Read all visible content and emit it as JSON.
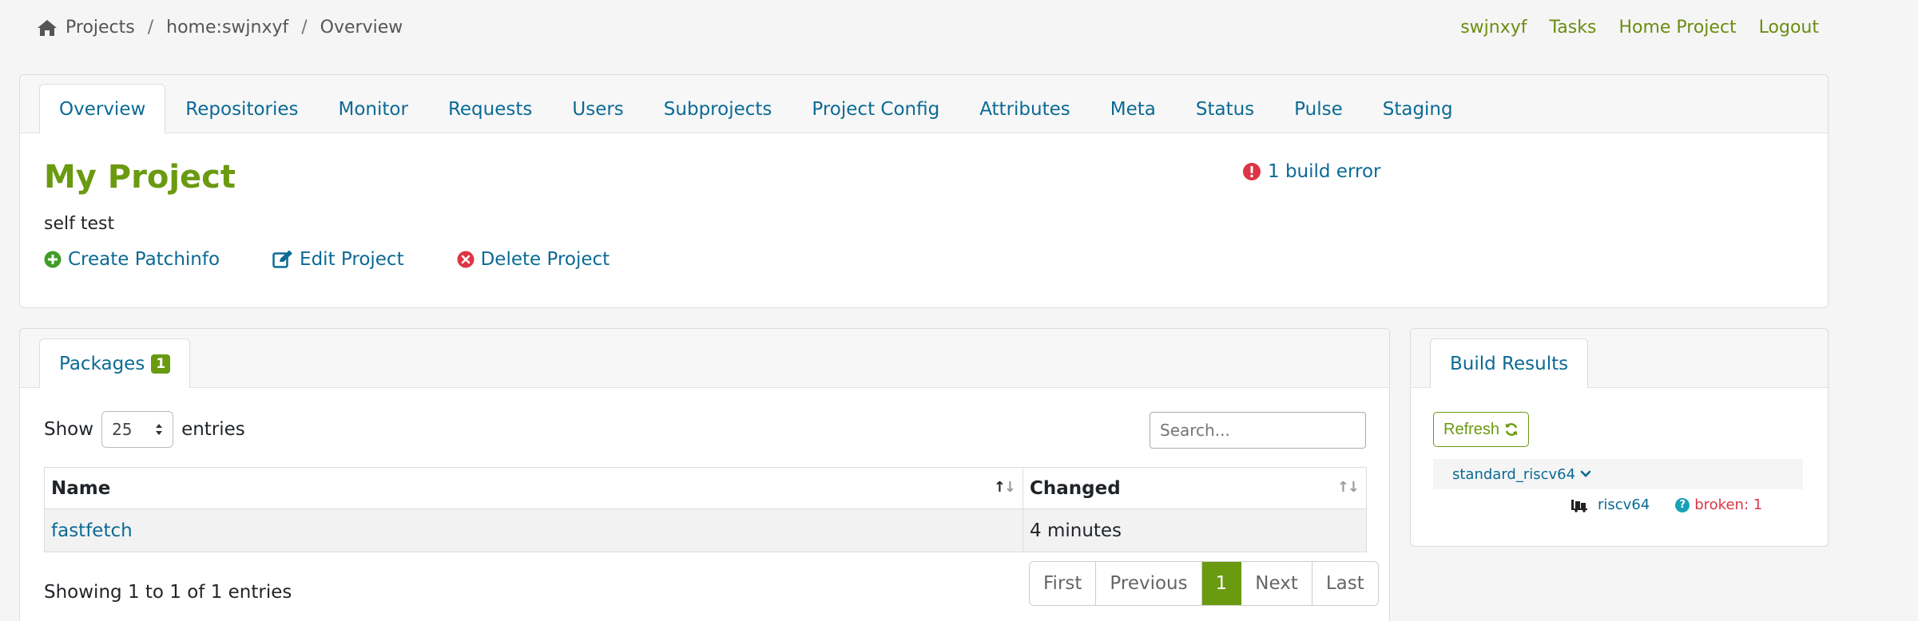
{
  "breadcrumb": {
    "items": [
      "Projects",
      "home:swjnxyf",
      "Overview"
    ],
    "separator": "/"
  },
  "user_nav": {
    "username": "swjnxyf",
    "tasks": "Tasks",
    "home_project": "Home Project",
    "logout": "Logout"
  },
  "project_tabs": [
    "Overview",
    "Repositories",
    "Monitor",
    "Requests",
    "Users",
    "Subprojects",
    "Project Config",
    "Attributes",
    "Meta",
    "Status",
    "Pulse",
    "Staging"
  ],
  "project": {
    "title": "My Project",
    "description": "self test",
    "build_error": "1 build error",
    "actions": {
      "create_patchinfo": "Create Patchinfo",
      "edit_project": "Edit Project",
      "delete_project": "Delete Project"
    }
  },
  "packages": {
    "tab_label": "Packages",
    "count_badge": "1",
    "show_label": "Show",
    "entries_label": "entries",
    "page_size": "25",
    "search_placeholder": "Search...",
    "columns": [
      "Name",
      "Changed"
    ],
    "rows": [
      {
        "name": "fastfetch",
        "changed": "4 minutes"
      }
    ],
    "showing_text": "Showing 1 to 1 of 1 entries",
    "pager": {
      "first": "First",
      "previous": "Previous",
      "current": "1",
      "next": "Next",
      "last": "Last"
    }
  },
  "build_results": {
    "tab_label": "Build Results",
    "refresh_label": "Refresh",
    "repository": "standard_riscv64",
    "arch": "riscv64",
    "status": "broken: 1"
  },
  "colors": {
    "accent_green": "#6a9a10",
    "link_blue": "#0b6a95",
    "error_red": "#dc3545",
    "info_cyan": "#17a2b8"
  },
  "icons": [
    "home-icon",
    "error-circle-icon",
    "plus-circle-icon",
    "edit-icon",
    "delete-circle-icon",
    "refresh-icon",
    "chevron-down-icon",
    "truck-icon",
    "question-circle-icon",
    "select-arrows-icon",
    "sort-icon"
  ]
}
